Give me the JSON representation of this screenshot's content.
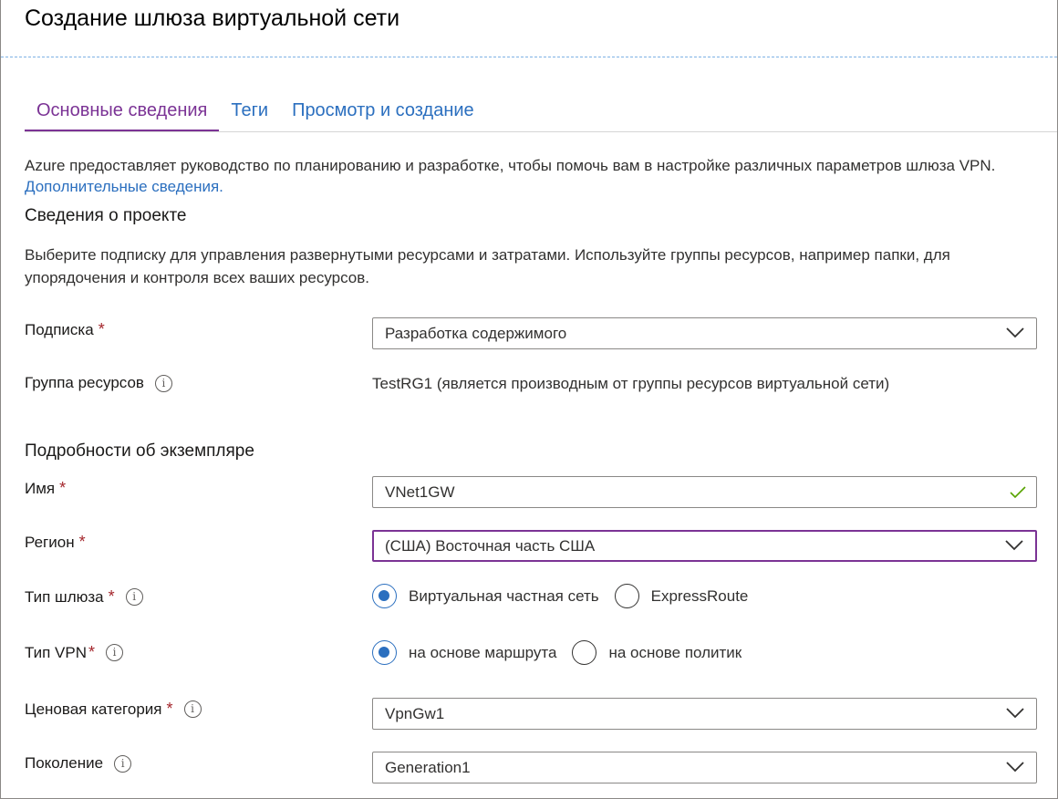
{
  "page": {
    "title": "Создание шлюза виртуальной сети"
  },
  "tabs": [
    {
      "label": "Основные сведения",
      "active": true
    },
    {
      "label": "Теги",
      "active": false
    },
    {
      "label": "Просмотр и создание",
      "active": false
    }
  ],
  "intro": {
    "text": "Azure предоставляет руководство по планированию и разработке, чтобы помочь вам в настройке различных параметров шлюза VPN.",
    "link": "Дополнительные сведения."
  },
  "project": {
    "title": "Сведения о проекте",
    "description": "Выберите подписку для управления развернутыми ресурсами и затратами. Используйте группы ресурсов, например папки, для упорядочения и контроля всех ваших ресурсов.",
    "subscription": {
      "label": "Подписка",
      "value": "Разработка содержимого"
    },
    "resource_group": {
      "label": "Группа ресурсов",
      "value": "TestRG1 (является производным от группы ресурсов виртуальной сети)"
    }
  },
  "instance": {
    "title": "Подробности об экземпляре",
    "name": {
      "label": "Имя",
      "value": "VNet1GW"
    },
    "region": {
      "label": "Регион",
      "value": "(США) Восточная часть США"
    },
    "gateway_type": {
      "label": "Тип шлюза",
      "options": [
        "Виртуальная частная сеть",
        "ExpressRoute"
      ],
      "selected": "Виртуальная частная сеть"
    },
    "vpn_type": {
      "label": "Тип VPN",
      "options": [
        "на основе маршрута",
        "на основе политик"
      ],
      "selected": "на основе маршрута"
    },
    "sku": {
      "label": "Ценовая категория",
      "value": "VpnGw1"
    },
    "generation": {
      "label": "Поколение",
      "value": "Generation1"
    }
  },
  "symbols": {
    "required": "*",
    "info": "i"
  },
  "colors": {
    "accent": "#7b3395",
    "link": "#2b6fbf",
    "required": "#a4262c",
    "valid": "#57a300"
  }
}
